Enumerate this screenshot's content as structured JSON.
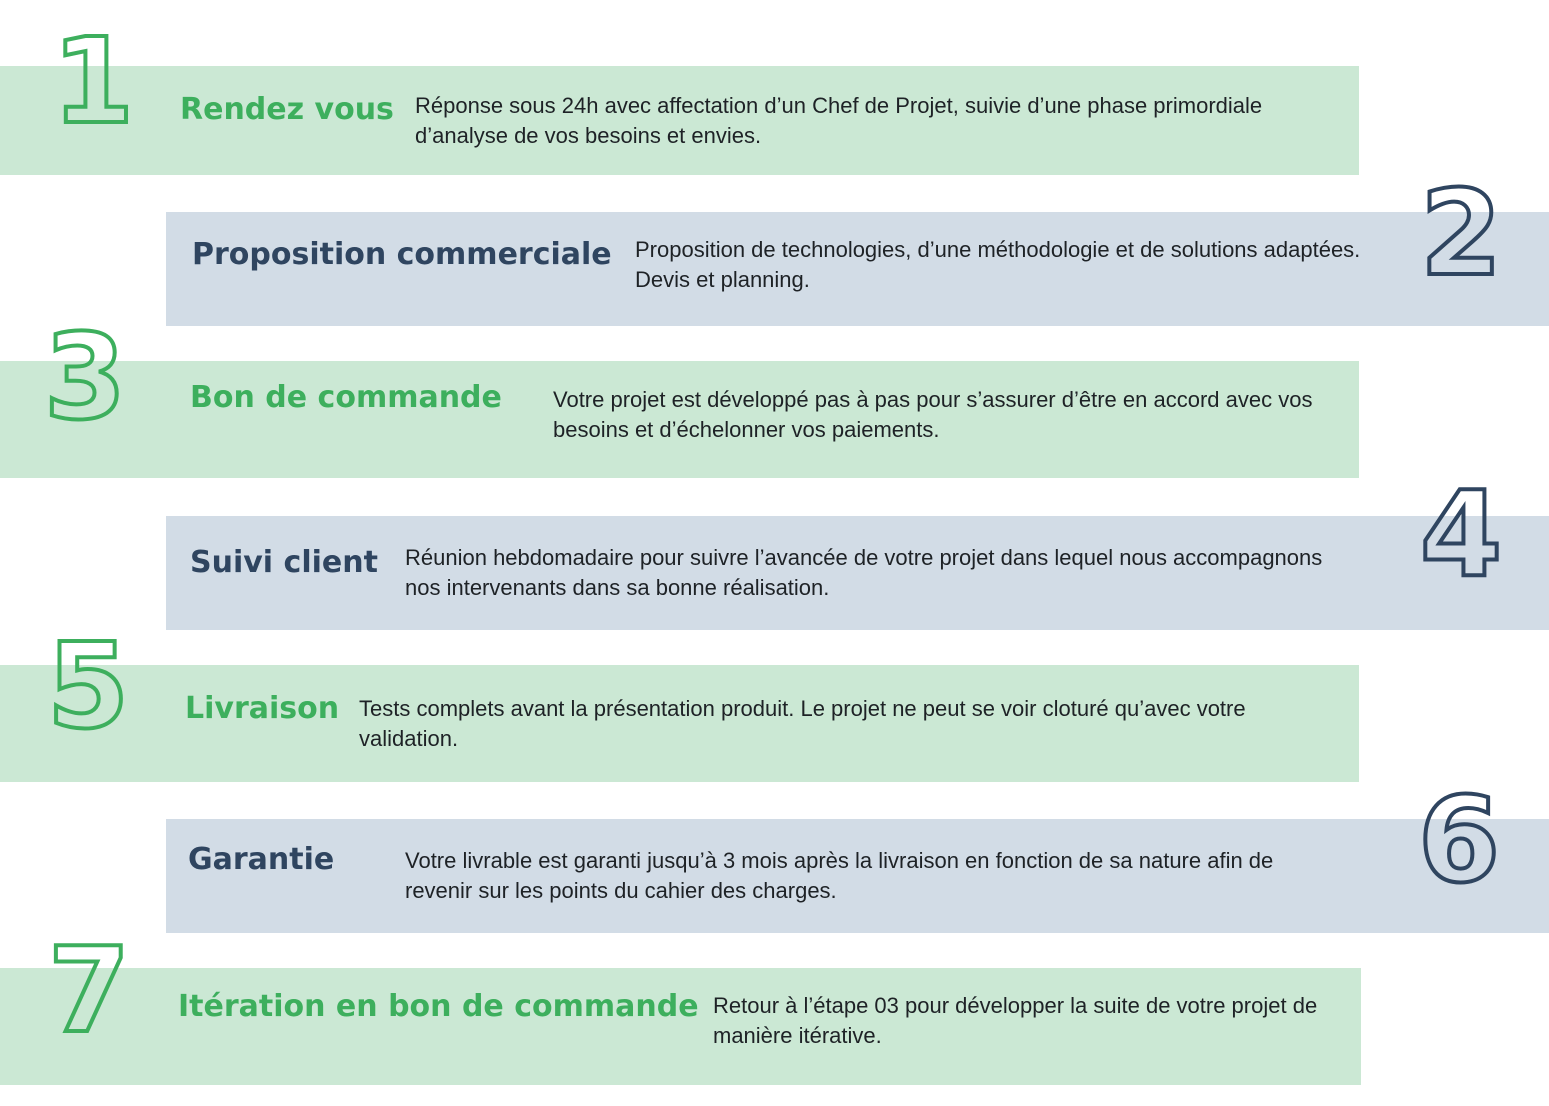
{
  "steps": [
    {
      "number": "1",
      "title": "Rendez vous",
      "description": "Réponse sous 24h avec affectation d’un Chef de Projet, suivie d’une phase primordiale d’analyse de vos besoins et envies."
    },
    {
      "number": "2",
      "title": "Proposition commerciale",
      "description": "Proposition de technologies, d’une méthodologie et de solutions adaptées. Devis et planning."
    },
    {
      "number": "3",
      "title": "Bon de commande",
      "description": "Votre projet est développé pas à pas pour s’assurer d’être en accord avec vos besoins et d’échelonner vos paiements."
    },
    {
      "number": "4",
      "title": "Suivi client",
      "description": "Réunion hebdomadaire pour suivre l’avancée de votre projet dans lequel nous accompagnons nos intervenants dans sa bonne réalisation."
    },
    {
      "number": "5",
      "title": "Livraison",
      "description": "Tests complets avant la présentation produit. Le projet ne peut se voir cloturé qu’avec votre validation."
    },
    {
      "number": "6",
      "title": "Garantie",
      "description": "Votre livrable est garanti jusqu’à 3 mois après la livraison en fonction de sa nature afin de revenir sur les points du cahier des charges."
    },
    {
      "number": "7",
      "title": "Itération en bon de commande",
      "description": "Retour à l’étape 03 pour développer la suite de votre projet de manière itérative."
    }
  ],
  "colors": {
    "green_band": "#cbe8d4",
    "blue_band": "#d2dce6",
    "green_accent": "#3daf5d",
    "blue_accent": "#2f4560"
  }
}
